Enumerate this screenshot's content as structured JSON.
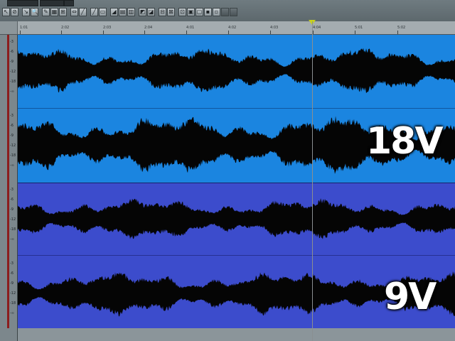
{
  "toolbar": {
    "selector_1": "",
    "selector_2": "",
    "buttons": [
      {
        "name": "select-tool-button",
        "glyph": "↖"
      },
      {
        "name": "no-entry-tool-button",
        "glyph": "⊘"
      },
      {
        "name": "split-tool-button",
        "glyph": "↘"
      },
      {
        "name": "zoom-tool-button",
        "glyph": "🔍"
      },
      {
        "name": "edit-tool-button",
        "glyph": "✎"
      },
      {
        "name": "grid-toggle-button",
        "glyph": "▦"
      },
      {
        "name": "snap-toggle-button",
        "glyph": "⊞"
      },
      {
        "name": "stretch-tool-button",
        "glyph": "⇔"
      },
      {
        "name": "pencil-tool-button",
        "glyph": "╱"
      },
      {
        "name": "curve-tool-button",
        "glyph": "╱"
      },
      {
        "name": "marker-button",
        "glyph": "▭"
      },
      {
        "name": "level-button",
        "glyph": "◢"
      },
      {
        "name": "list-button",
        "glyph": "▤"
      },
      {
        "name": "mixer-button",
        "glyph": "▥"
      },
      {
        "name": "envelope-button",
        "glyph": "◩"
      },
      {
        "name": "view-button",
        "glyph": "◪"
      },
      {
        "name": "link-button",
        "glyph": "⊟"
      },
      {
        "name": "group-button",
        "glyph": "⊠"
      },
      {
        "name": "align-button",
        "glyph": "⊡"
      },
      {
        "name": "track-add-button",
        "glyph": "▣"
      },
      {
        "name": "track-remove-button",
        "glyph": "▢"
      },
      {
        "name": "record-button",
        "glyph": "▪"
      },
      {
        "name": "loop-button",
        "glyph": "▫"
      },
      {
        "name": "blank-button-1",
        "glyph": ""
      },
      {
        "name": "blank-button-2",
        "glyph": ""
      }
    ]
  },
  "ruler": {
    "ticks": [
      "1:01",
      "2:02",
      "2:03",
      "2:04",
      "4:01",
      "4:02",
      "4:03",
      "4:04",
      "5:01",
      "5:02"
    ]
  },
  "tracks": [
    {
      "label": "18V",
      "color": "#1b85e0"
    },
    {
      "label": "9V",
      "color": "#3c4ccc"
    }
  ],
  "gutter_scale": [
    "-3",
    "-6",
    "-9",
    "-12",
    "-18",
    "-∞"
  ],
  "playhead_color": "#c9d21c"
}
